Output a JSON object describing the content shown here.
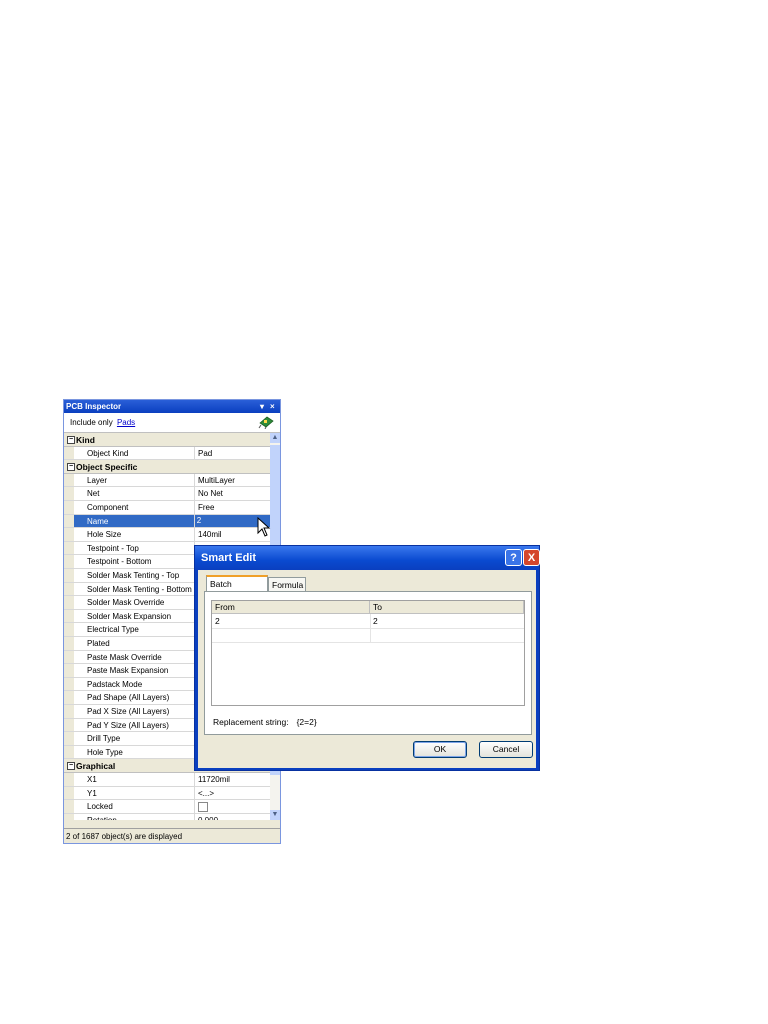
{
  "inspector": {
    "title": "PCB Inspector",
    "dropdown_glyph": "▾",
    "close_glyph": "×",
    "filter_prefix": "Include only",
    "filter_link": "Pads",
    "status": "2 of 1687 object(s) are displayed",
    "scroll_up": "▲",
    "scroll_down": "▼",
    "categories": {
      "kind": "Kind",
      "object_specific": "Object Specific",
      "graphical": "Graphical"
    },
    "kind_rows": [
      {
        "name": "Object Kind",
        "value": "Pad"
      }
    ],
    "specific_rows": [
      {
        "name": "Layer",
        "value": "MultiLayer"
      },
      {
        "name": "Net",
        "value": "No Net"
      },
      {
        "name": "Component",
        "value": "Free"
      },
      {
        "name": "Name",
        "value": "2"
      },
      {
        "name": "Hole Size",
        "value": "140mil"
      },
      {
        "name": "Testpoint - Top",
        "value": ""
      },
      {
        "name": "Testpoint - Bottom",
        "value": ""
      },
      {
        "name": "Solder Mask Tenting - Top",
        "value": ""
      },
      {
        "name": "Solder Mask Tenting - Bottom",
        "value": ""
      },
      {
        "name": "Solder Mask Override",
        "value": ""
      },
      {
        "name": "Solder Mask Expansion",
        "value": ""
      },
      {
        "name": "Electrical Type",
        "value": ""
      },
      {
        "name": "Plated",
        "value": ""
      },
      {
        "name": "Paste Mask Override",
        "value": ""
      },
      {
        "name": "Paste Mask Expansion",
        "value": ""
      },
      {
        "name": "Padstack Mode",
        "value": ""
      },
      {
        "name": "Pad Shape (All Layers)",
        "value": ""
      },
      {
        "name": "Pad X Size (All Layers)",
        "value": ""
      },
      {
        "name": "Pad Y Size (All Layers)",
        "value": ""
      },
      {
        "name": "Drill Type",
        "value": ""
      },
      {
        "name": "Hole Type",
        "value": ""
      }
    ],
    "graphical_rows": [
      {
        "name": "X1",
        "value": "11720mil"
      },
      {
        "name": "Y1",
        "value": "<...>"
      },
      {
        "name": "Locked",
        "value": ""
      },
      {
        "name": "Rotation",
        "value": "0.000"
      }
    ],
    "selected_row": "Name"
  },
  "dialog": {
    "title": "Smart Edit",
    "help_glyph": "?",
    "close_glyph": "X",
    "tabs": [
      "Batch Replace",
      "Formula"
    ],
    "columns": [
      "From",
      "To"
    ],
    "rows": [
      {
        "from": "2",
        "to": "2"
      }
    ],
    "replacement_label": "Replacement string:",
    "replacement_value": "{2=2}",
    "ok_label": "OK",
    "cancel_label": "Cancel"
  },
  "colors": {
    "titlebar": "#0a3fbf",
    "selection": "#316ac5",
    "close_button": "#d4462c",
    "panel_bg": "#ece9d8"
  }
}
